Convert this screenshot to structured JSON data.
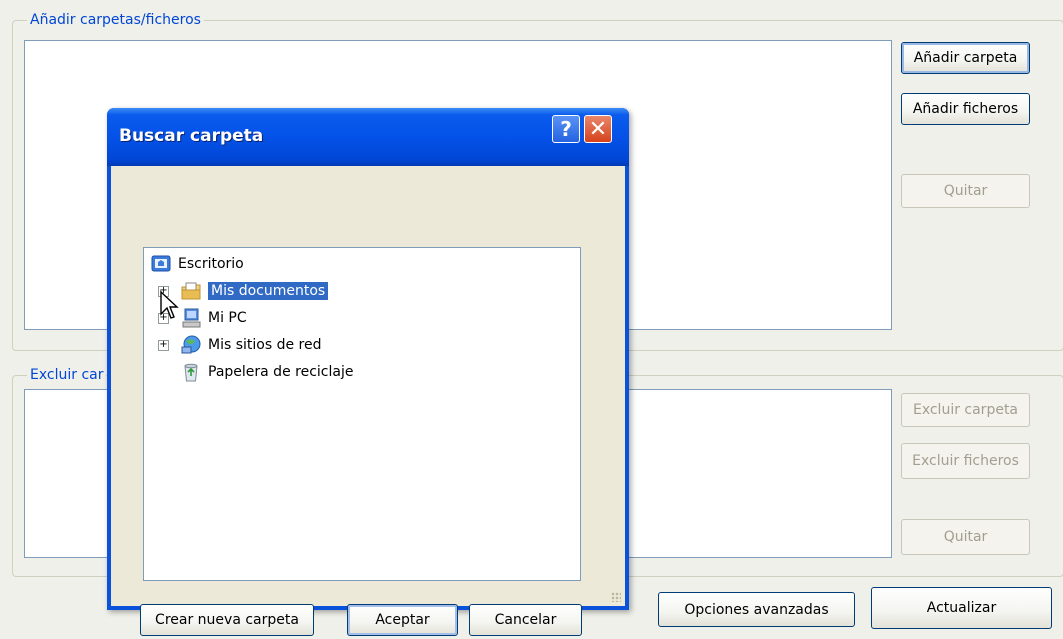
{
  "add_group": {
    "label": "Añadir carpetas/ficheros",
    "add_folder_button": "Añadir carpeta",
    "add_files_button": "Añadir ficheros",
    "remove_button": "Quitar"
  },
  "exclude_group": {
    "label": "Excluir car",
    "exclude_folder_button": "Excluir carpeta",
    "exclude_files_button": "Excluir ficheros",
    "remove_button": "Quitar"
  },
  "footer": {
    "advanced_button": "Opciones avanzadas",
    "update_button": "Actualizar"
  },
  "dialog": {
    "title": "Buscar carpeta",
    "help_glyph": "?",
    "close_glyph": "✕",
    "tree": [
      {
        "label": "Escritorio",
        "icon": "desktop-icon",
        "expander": ""
      },
      {
        "label": "Mis documentos",
        "icon": "my-documents-icon",
        "expander": "+",
        "selected": true
      },
      {
        "label": "Mi PC",
        "icon": "my-computer-icon",
        "expander": "+"
      },
      {
        "label": "Mis sitios de red",
        "icon": "network-places-icon",
        "expander": "+"
      },
      {
        "label": "Papelera de reciclaje",
        "icon": "recycle-bin-icon",
        "expander": ""
      }
    ],
    "new_folder_button": "Crear nueva carpeta",
    "ok_button": "Aceptar",
    "cancel_button": "Cancelar"
  },
  "colors": {
    "group_label": "#0046d5",
    "title_bar": "#0452e8",
    "selection": "#316ac5"
  }
}
